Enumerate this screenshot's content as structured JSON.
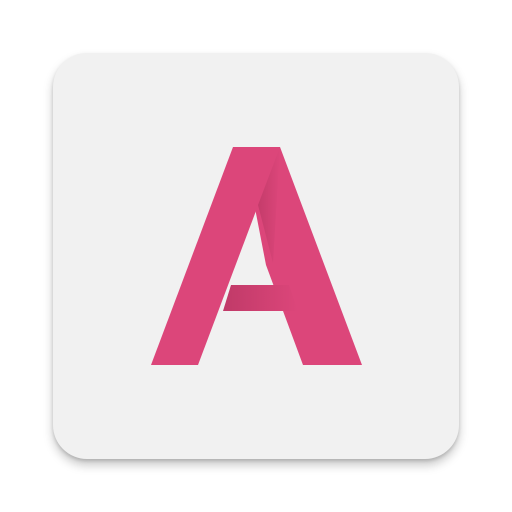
{
  "app_icon": {
    "name": "app-launcher-icon",
    "logo_glyph": "A",
    "logo_icon": "letter-a-logo-icon",
    "colors": {
      "tile_background": "#f1f1f1",
      "logo_primary": "#dc467a",
      "logo_shadow": "#c03a68",
      "logo_highlight": "#e0588a"
    }
  }
}
